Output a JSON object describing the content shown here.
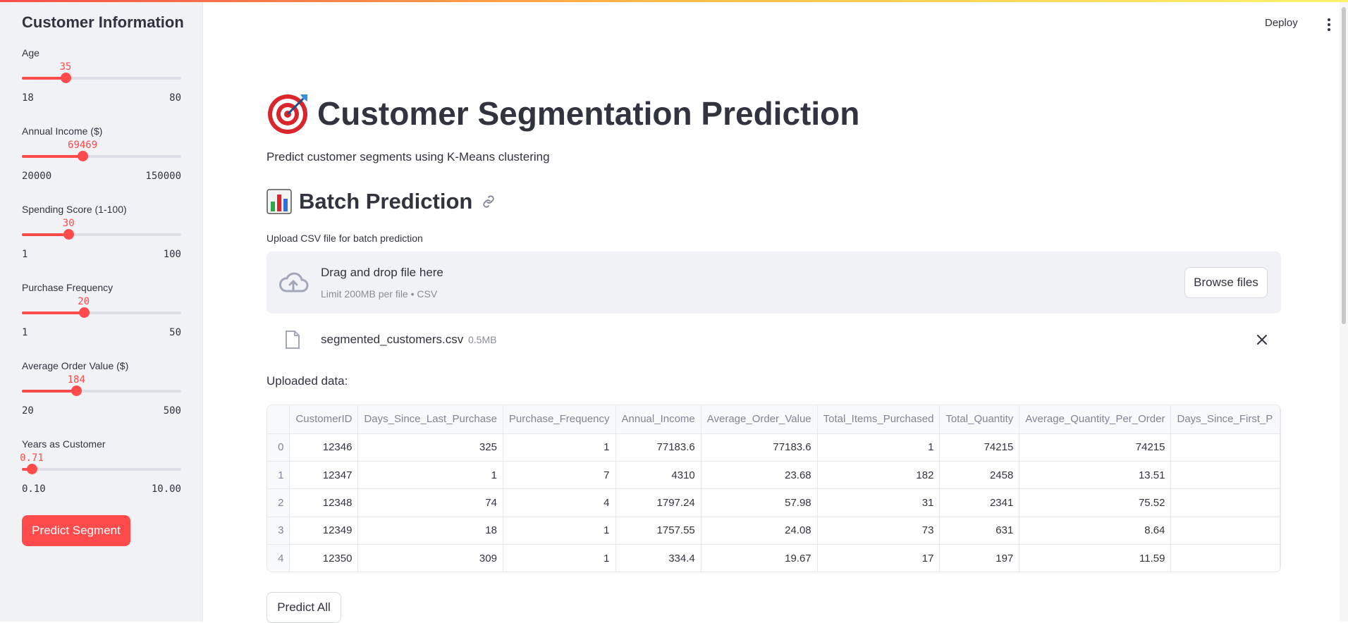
{
  "sidebar": {
    "title": "Customer Information",
    "sliders": [
      {
        "label": "Age",
        "value": "35",
        "min": "18",
        "max": "80",
        "fraction": 0.274
      },
      {
        "label": "Annual Income ($)",
        "value": "69469",
        "min": "20000",
        "max": "150000",
        "fraction": 0.381
      },
      {
        "label": "Spending Score (1-100)",
        "value": "30",
        "min": "1",
        "max": "100",
        "fraction": 0.293
      },
      {
        "label": "Purchase Frequency",
        "value": "20",
        "min": "1",
        "max": "50",
        "fraction": 0.388
      },
      {
        "label": "Average Order Value ($)",
        "value": "184",
        "min": "20",
        "max": "500",
        "fraction": 0.342
      },
      {
        "label": "Years as Customer",
        "value": "0.71",
        "min": "0.10",
        "max": "10.00",
        "fraction": 0.062
      }
    ],
    "predict_button": "Predict Segment"
  },
  "header": {
    "deploy": "Deploy"
  },
  "main": {
    "title": "Customer Segmentation Prediction",
    "subtitle": "Predict customer segments using K-Means clustering",
    "batch_heading": "Batch Prediction",
    "upload_label": "Upload CSV file for batch prediction",
    "dropzone": {
      "title": "Drag and drop file here",
      "subtitle": "Limit 200MB per file • CSV",
      "browse": "Browse files"
    },
    "file": {
      "name": "segmented_customers.csv",
      "size": "0.5MB"
    },
    "uploaded_label": "Uploaded data:",
    "table": {
      "columns": [
        "",
        "CustomerID",
        "Days_Since_Last_Purchase",
        "Purchase_Frequency",
        "Annual_Income",
        "Average_Order_Value",
        "Total_Items_Purchased",
        "Total_Quantity",
        "Average_Quantity_Per_Order",
        "Days_Since_First_P"
      ],
      "rows": [
        [
          "0",
          "12346",
          "325",
          "1",
          "77183.6",
          "77183.6",
          "1",
          "74215",
          "74215",
          ""
        ],
        [
          "1",
          "12347",
          "1",
          "7",
          "4310",
          "23.68",
          "182",
          "2458",
          "13.51",
          ""
        ],
        [
          "2",
          "12348",
          "74",
          "4",
          "1797.24",
          "57.98",
          "31",
          "2341",
          "75.52",
          ""
        ],
        [
          "3",
          "12349",
          "18",
          "1",
          "1757.55",
          "24.08",
          "73",
          "631",
          "8.64",
          ""
        ],
        [
          "4",
          "12350",
          "309",
          "1",
          "334.4",
          "19.67",
          "17",
          "197",
          "11.59",
          ""
        ]
      ]
    },
    "predict_all": "Predict All"
  },
  "colors": {
    "accent": "#ff4b4b",
    "sidebar_bg": "#f0f2f6",
    "text": "#31333f"
  },
  "icons": [
    "target-icon",
    "bar-chart-icon",
    "link-icon",
    "cloud-upload-icon",
    "file-icon",
    "close-icon",
    "kebab-menu-icon"
  ]
}
